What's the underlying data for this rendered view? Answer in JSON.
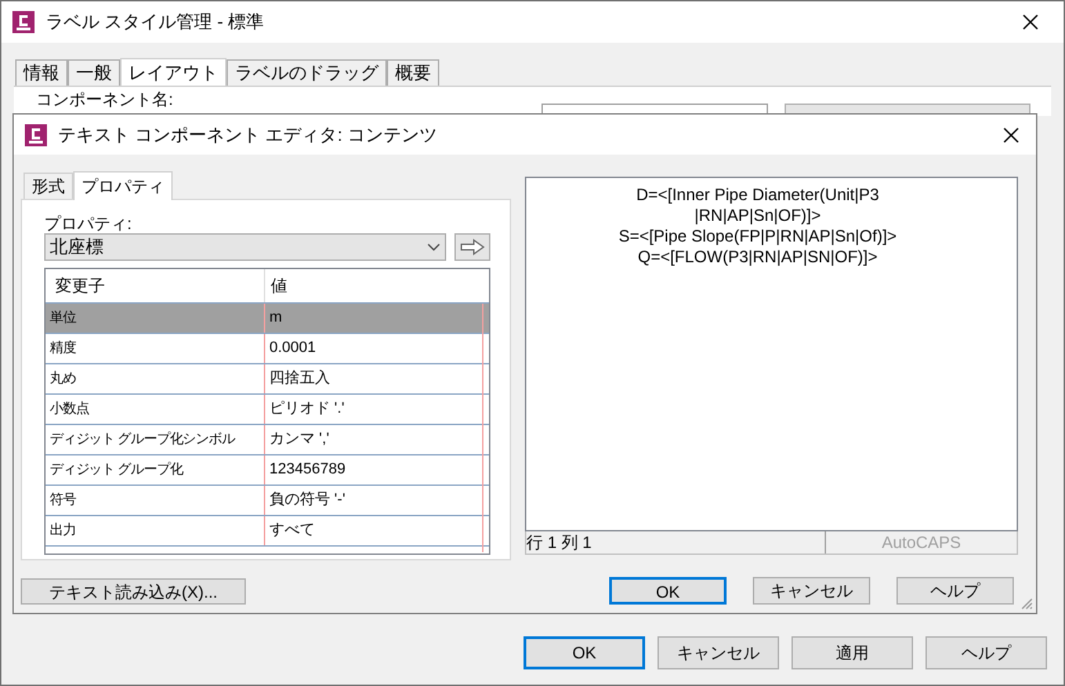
{
  "window": {
    "title": "ラベル スタイル管理 - 標準",
    "tabs": [
      {
        "label": "情報",
        "selected": false
      },
      {
        "label": "一般",
        "selected": false
      },
      {
        "label": "レイアウト",
        "selected": true
      },
      {
        "label": "ラベルのドラッグ",
        "selected": false
      },
      {
        "label": "概要",
        "selected": false
      }
    ],
    "component_label": "コンポーネント名:"
  },
  "editor": {
    "title": "テキスト コンポーネント エディタ: コンテンツ",
    "tabs": [
      {
        "label": "形式",
        "selected": false
      },
      {
        "label": "プロパティ",
        "selected": true
      }
    ],
    "property_label": "プロパティ:",
    "property_dropdown": {
      "value": "北座標"
    },
    "grid": {
      "columns": [
        "変更子",
        "値"
      ],
      "rows": [
        {
          "modifier": "単位",
          "value": "m",
          "selected": true
        },
        {
          "modifier": "精度",
          "value": "0.0001",
          "selected": false
        },
        {
          "modifier": "丸め",
          "value": "四捨五入",
          "selected": false
        },
        {
          "modifier": "小数点",
          "value": "ピリオド '.'",
          "selected": false
        },
        {
          "modifier": "ディジット グループ化シンボル",
          "value": "カンマ ','",
          "selected": false
        },
        {
          "modifier": "ディジット グループ化",
          "value": "123456789",
          "selected": false
        },
        {
          "modifier": "符号",
          "value": "負の符号 '-'",
          "selected": false
        },
        {
          "modifier": "出力",
          "value": "すべて",
          "selected": false
        }
      ]
    },
    "import_button": "テキスト読み込み(X)...",
    "text_lines": [
      "D=<[Inner Pipe Diameter(Unit|P3",
      "|RN|AP|Sn|OF)]>",
      "S=<[Pipe Slope(FP|P|RN|AP|Sn|Of)]>",
      "Q=<[FLOW(P3|RN|AP|SN|OF)]>"
    ],
    "status": {
      "position": "行 1 列 1",
      "caps": "AutoCAPS",
      "caps_disabled": true
    },
    "buttons": [
      {
        "label": "OK",
        "default": true
      },
      {
        "label": "キャンセル",
        "default": false
      },
      {
        "label": "ヘルプ",
        "default": false
      }
    ]
  },
  "buttons": [
    {
      "label": "OK",
      "default": true
    },
    {
      "label": "キャンセル",
      "default": false
    },
    {
      "label": "適用",
      "default": false
    },
    {
      "label": "ヘルプ",
      "default": false
    }
  ]
}
